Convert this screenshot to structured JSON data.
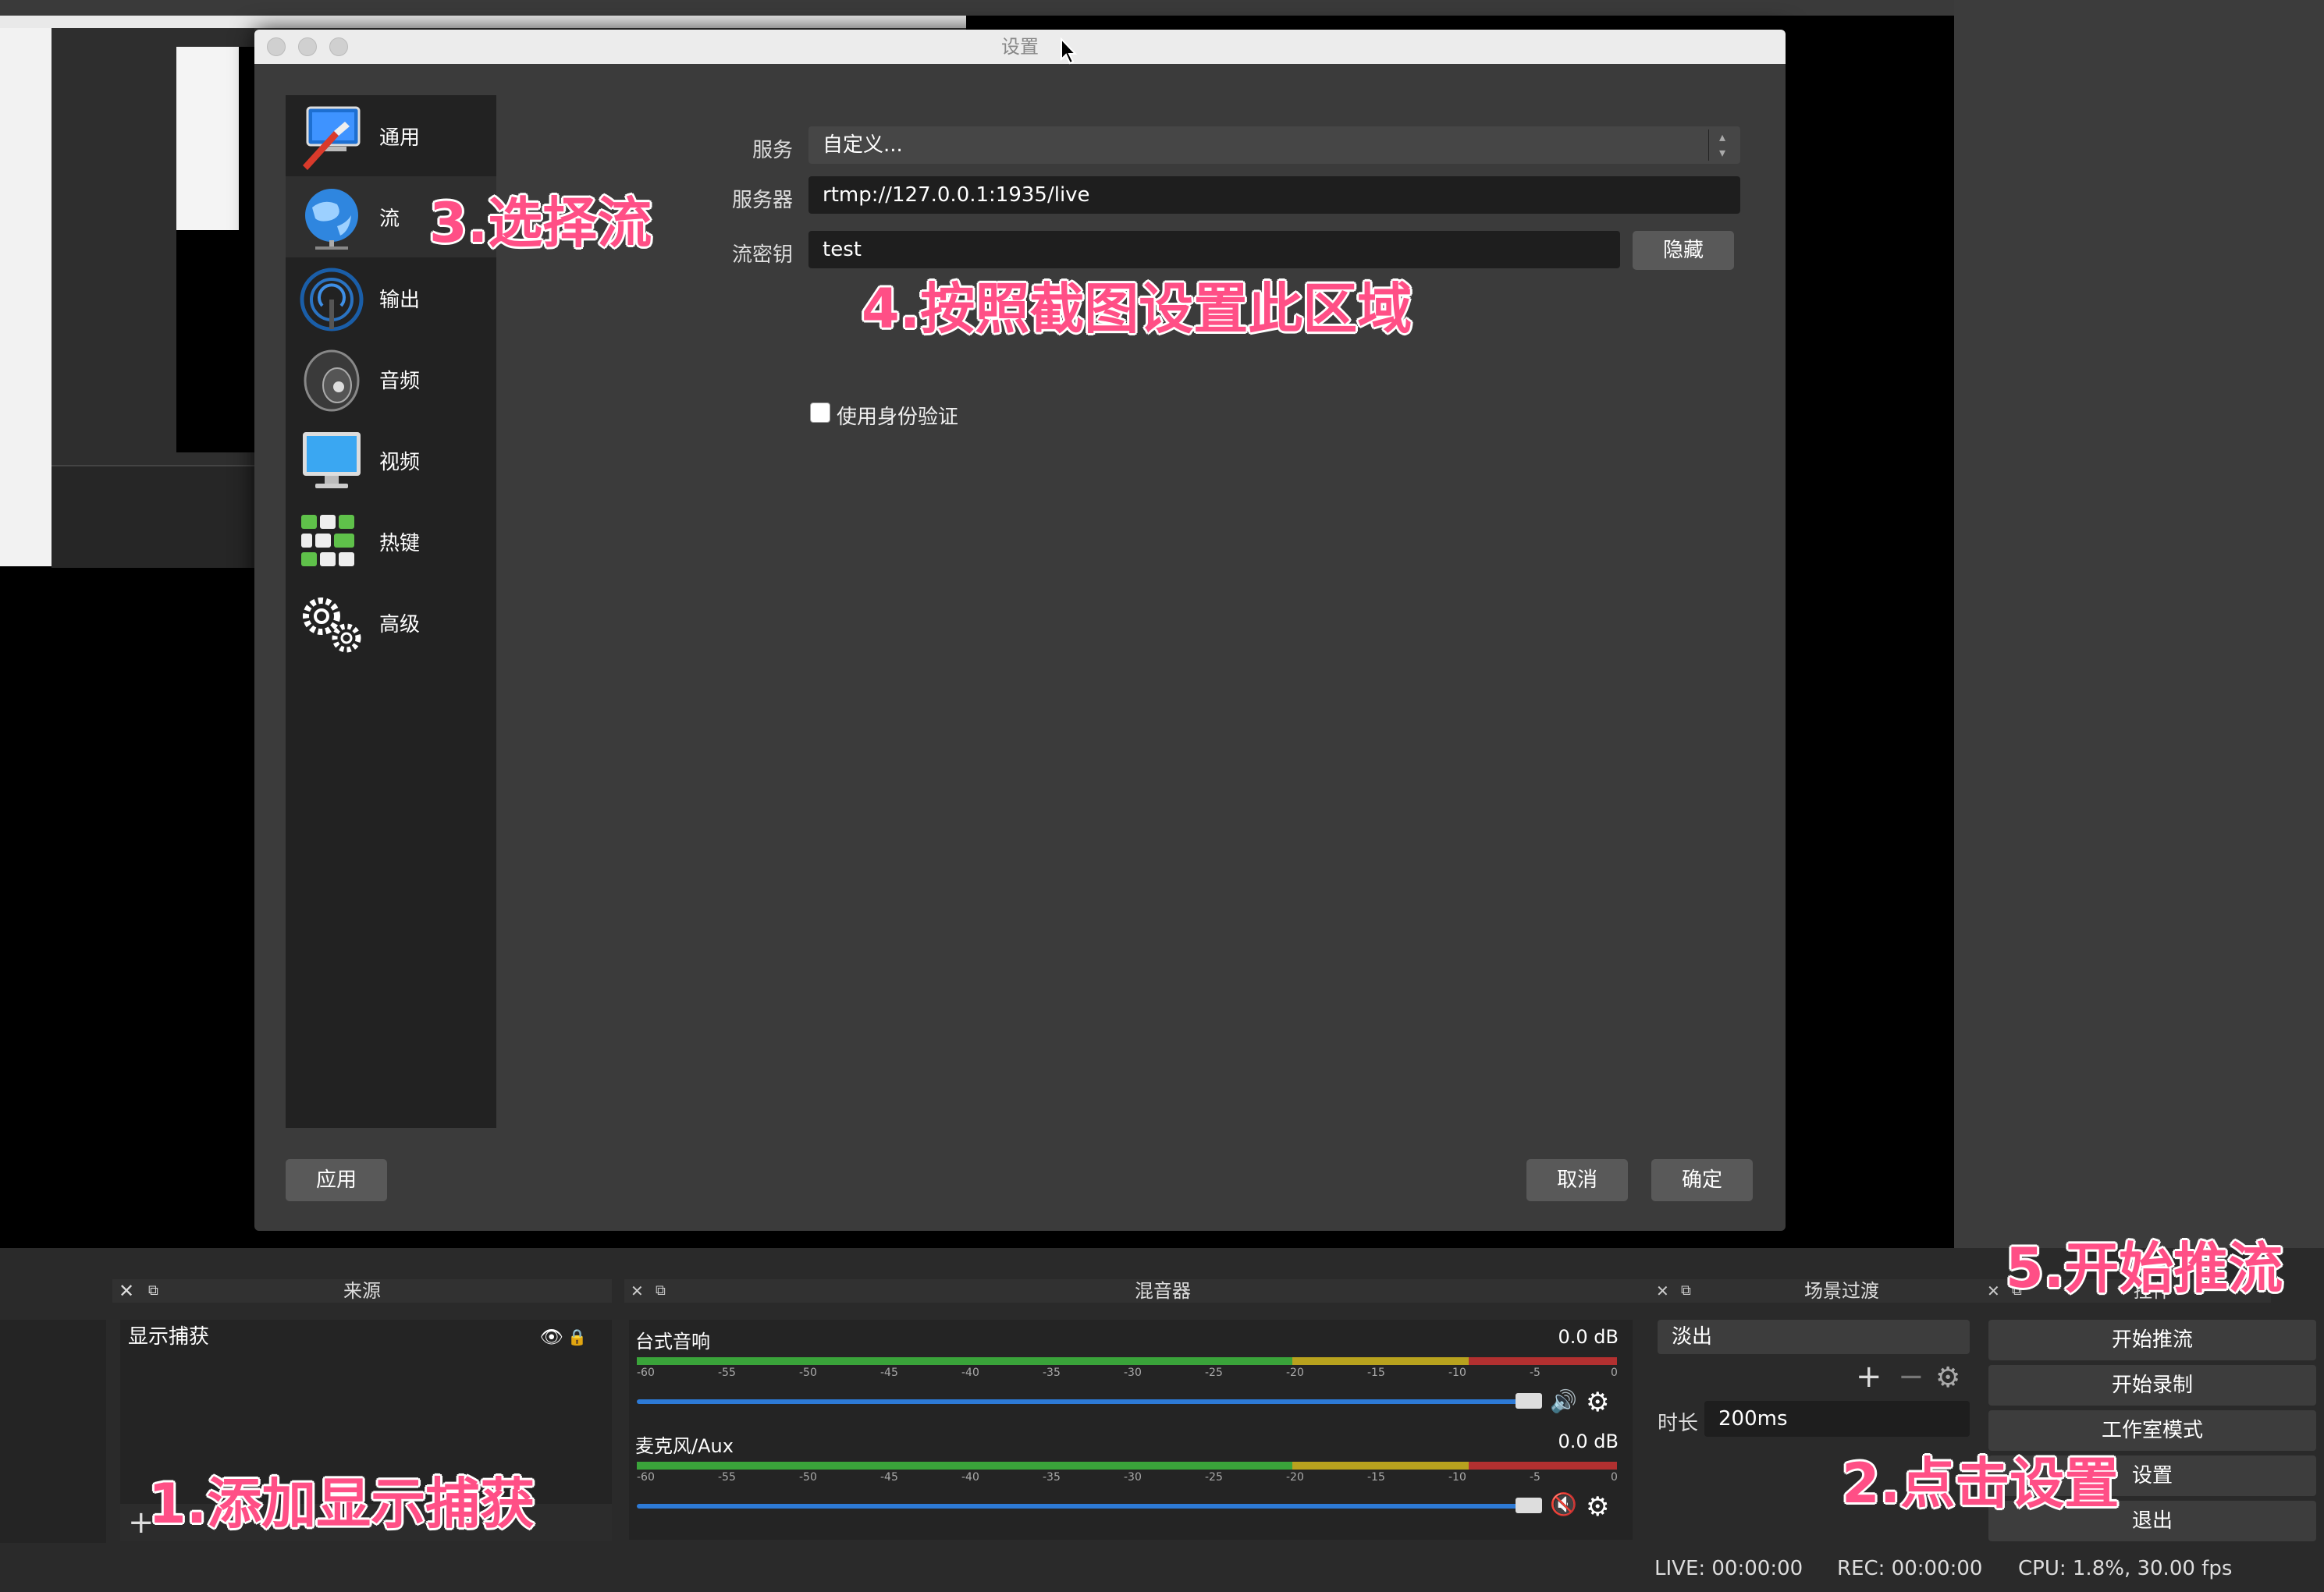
{
  "dialog": {
    "title": "设置",
    "categories": [
      {
        "label": "通用",
        "icon": "general-icon"
      },
      {
        "label": "流",
        "icon": "stream-globe-icon"
      },
      {
        "label": "输出",
        "icon": "output-icon"
      },
      {
        "label": "音频",
        "icon": "audio-speaker-icon"
      },
      {
        "label": "视频",
        "icon": "video-monitor-icon"
      },
      {
        "label": "热键",
        "icon": "hotkeys-keyboard-icon"
      },
      {
        "label": "高级",
        "icon": "advanced-gears-icon"
      }
    ],
    "selected_category": "流",
    "service_label": "服务",
    "service_value": "自定义...",
    "server_label": "服务器",
    "server_value": "rtmp://127.0.0.1:1935/live",
    "stream_key_label": "流密钥",
    "stream_key_value": "test",
    "hide_button": "隐藏",
    "auth_checkbox_label": "使用身份验证",
    "auth_checked": false,
    "apply_button": "应用",
    "cancel_button": "取消",
    "ok_button": "确定"
  },
  "annotations": {
    "step1": "1.添加显示捕获",
    "step2": "2.点击设置",
    "step3": "3.选择流",
    "step4": "4.按照截图设置此区域",
    "step5": "5.开始推流"
  },
  "docks": {
    "sources": {
      "title": "来源",
      "items": [
        "显示捕获"
      ],
      "add_symbol": "+"
    },
    "mixer": {
      "title": "混音器",
      "channels": [
        {
          "name": "台式音响",
          "db": "0.0 dB",
          "muted": false
        },
        {
          "name": "麦克风/Aux",
          "db": "0.0 dB",
          "muted": true
        }
      ],
      "scale": [
        "-60",
        "-55",
        "-50",
        "-45",
        "-40",
        "-35",
        "-30",
        "-25",
        "-20",
        "-15",
        "-10",
        "-5",
        "0"
      ]
    },
    "transitions": {
      "title": "场景过渡",
      "selected": "淡出",
      "duration_label": "时长",
      "duration_value": "200ms"
    },
    "controls": {
      "title": "控件",
      "buttons": [
        "开始推流",
        "开始录制",
        "工作室模式",
        "设置",
        "退出"
      ]
    }
  },
  "status_bar": {
    "live": "LIVE: 00:00:00",
    "rec": "REC: 00:00:00",
    "cpu": "CPU: 1.8%, 30.00 fps"
  },
  "colors": {
    "annotation": "#ff4f86",
    "meter_green": "#3aa33a",
    "meter_yellow": "#b8a21e",
    "meter_red": "#b23030",
    "slider_blue": "#2d7ad6"
  }
}
